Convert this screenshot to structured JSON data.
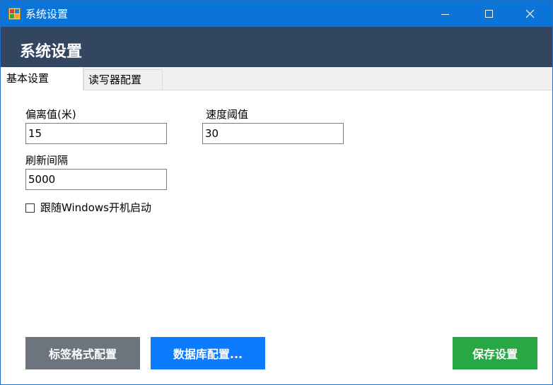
{
  "window": {
    "title": "系统设置",
    "icon": "app-window-icon",
    "controls": [
      "minimize-icon",
      "maximize-icon",
      "close-icon"
    ]
  },
  "header": {
    "title": "系统设置",
    "background": "#334660"
  },
  "tabs": [
    {
      "label": "基本设置",
      "selected": true
    },
    {
      "label": "读写器配置",
      "selected": false
    }
  ],
  "basic": {
    "offset": {
      "label": "偏离值(米)",
      "value": "15"
    },
    "speed_threshold": {
      "label": "速度阈值",
      "value": "30"
    },
    "refresh_interval": {
      "label": "刷新间隔",
      "value": "5000"
    },
    "autostart": {
      "label": "跟随Windows开机启动",
      "checked": false
    }
  },
  "buttons": {
    "label_format": {
      "label": "标签格式配置",
      "color": "#6c757d"
    },
    "database": {
      "label": "数据库配置...",
      "color": "#0d7bfd"
    },
    "save": {
      "label": "保存设置",
      "color": "#28a745"
    }
  }
}
